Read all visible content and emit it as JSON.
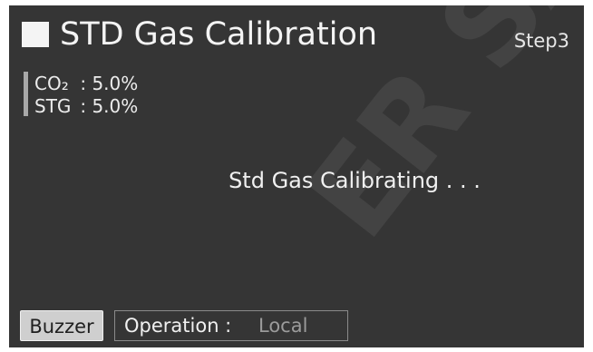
{
  "header": {
    "title": "STD Gas Calibration",
    "step": "Step3"
  },
  "gases": [
    {
      "name": "CO₂",
      "value": ": 5.0%"
    },
    {
      "name": "STG",
      "value": ": 5.0%"
    }
  ],
  "status_text": "Std Gas Calibrating . . .",
  "footer": {
    "buzzer_label": "Buzzer",
    "operation_label": "Operation :",
    "operation_value": "Local"
  }
}
